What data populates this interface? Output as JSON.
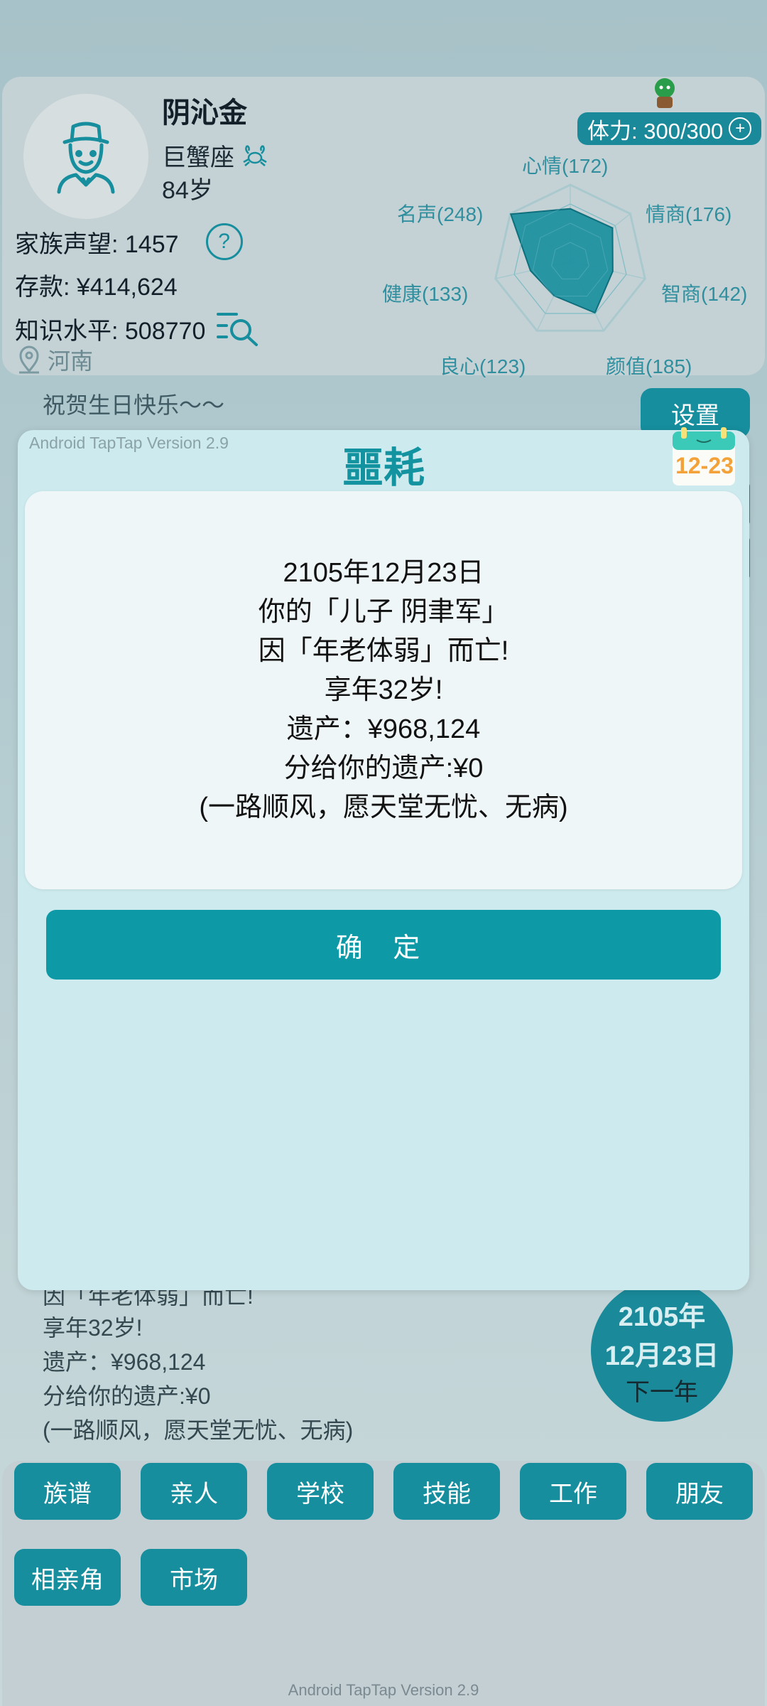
{
  "profile": {
    "name": "阴沁金",
    "zodiac": "巨蟹座",
    "age": "84岁",
    "family_reputation": "家族声望: 1457",
    "savings": "存款: ¥414,624",
    "knowledge": "知识水平: 508770",
    "location": "河南",
    "stamina": "体力: 300/300"
  },
  "radar": {
    "labels": [
      {
        "text": "心情(172)",
        "value": 172
      },
      {
        "text": "情商(176)",
        "value": 176
      },
      {
        "text": "智商(142)",
        "value": 142
      },
      {
        "text": "颜值(185)",
        "value": 185
      },
      {
        "text": "良心(123)",
        "value": 123
      },
      {
        "text": "健康(133)",
        "value": 133
      },
      {
        "text": "名声(248)",
        "value": 248
      }
    ],
    "color": "#178e9d"
  },
  "greeting": "祝贺生日快乐〜〜",
  "settings_label": "设置",
  "log_lines": [
    "因「年老体弱」而亡!",
    "享年32岁!",
    "遗产：¥968,124",
    "分给你的遗产:¥0",
    "(一路顺风，愿天堂无忧、无病)"
  ],
  "date_circle": {
    "year": "2105年",
    "month_day": "12月23日",
    "next_label": "下一年"
  },
  "nav": [
    "族谱",
    "亲人",
    "学校",
    "技能",
    "工作",
    "朋友",
    "相亲角",
    "市场"
  ],
  "footer_version": "Android TapTap Version 2.9",
  "modal": {
    "version": "Android TapTap Version 2.9",
    "title": "噩耗",
    "calendar_date": "12-23",
    "message": [
      "2105年12月23日",
      "你的「儿子 阴聿军」",
      "因「年老体弱」而亡!",
      "享年32岁!",
      "遗产：¥968,124",
      "分给你的遗产:¥0",
      "(一路顺风，愿天堂无忧、无病)"
    ],
    "confirm_label": "确 定"
  },
  "colors": {
    "accent": "#168e9e",
    "modal_bg": "#cdeaee",
    "calendar_text": "#f3a23a"
  }
}
